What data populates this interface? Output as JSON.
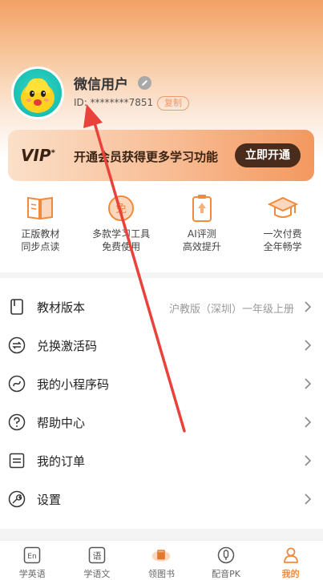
{
  "profile": {
    "nickname": "微信用户",
    "id_text": "ID: ********7851",
    "copy_label": "复制"
  },
  "vip": {
    "logo": "VIP",
    "logo_mark": "*",
    "text": "开通会员获得更多学习功能",
    "button": "立即开通"
  },
  "features": [
    {
      "icon": "book-icon",
      "line1": "正版教材",
      "line2": "同步点读"
    },
    {
      "icon": "free-tools-icon",
      "line1": "多款学习工具",
      "line2": "免费使用"
    },
    {
      "icon": "ai-evaluation-icon",
      "line1": "AI评测",
      "line2": "高效提升"
    },
    {
      "icon": "graduation-cap-icon",
      "line1": "一次付费",
      "line2": "全年畅学"
    }
  ],
  "menu": [
    {
      "icon": "textbook-icon",
      "label": "教材版本",
      "value": "沪教版（深圳）一年级上册"
    },
    {
      "icon": "exchange-icon",
      "label": "兑换激活码",
      "value": ""
    },
    {
      "icon": "mini-program-icon",
      "label": "我的小程序码",
      "value": ""
    },
    {
      "icon": "help-icon",
      "label": "帮助中心",
      "value": ""
    },
    {
      "icon": "order-icon",
      "label": "我的订单",
      "value": ""
    },
    {
      "icon": "wrench-icon",
      "label": "设置",
      "value": ""
    }
  ],
  "tabs": [
    {
      "icon": "english-icon",
      "glyph": "En",
      "label": "学英语"
    },
    {
      "icon": "chinese-icon",
      "glyph": "语",
      "label": "学语文"
    },
    {
      "icon": "get-book-icon",
      "glyph": "",
      "label": "领图书"
    },
    {
      "icon": "dubbing-icon",
      "glyph": "",
      "label": "配音PK"
    },
    {
      "icon": "profile-icon",
      "glyph": "",
      "label": "我的"
    }
  ],
  "colors": {
    "accent": "#f08a3c",
    "vip_button": "#4a2c1c",
    "arrow": "#e8423b"
  }
}
